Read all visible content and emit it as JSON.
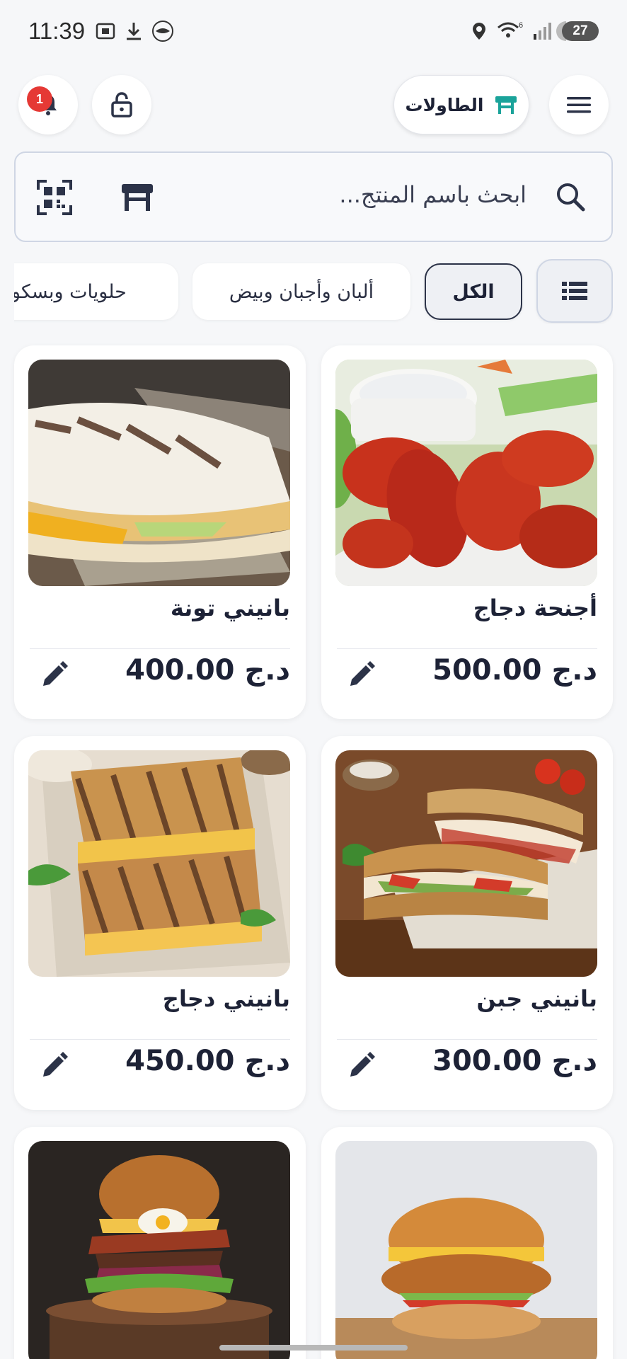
{
  "status_bar": {
    "time": "11:39",
    "battery": "27",
    "signal_label": "6"
  },
  "header": {
    "tables_label": "الطاولات",
    "notification_count": "1"
  },
  "search": {
    "placeholder": "ابحث باسم المنتج..."
  },
  "categories": [
    {
      "label": "الكل",
      "selected": true
    },
    {
      "label": "ألبان وأجبان وبيض",
      "selected": false
    },
    {
      "label": "حلويات وبسكويت",
      "selected": false
    }
  ],
  "products": [
    {
      "name": "أجنحة دجاج",
      "price": "500.00",
      "currency": "د.ج",
      "image": "chicken-wings"
    },
    {
      "name": "بانيني تونة",
      "price": "400.00",
      "currency": "د.ج",
      "image": "tuna-panini"
    },
    {
      "name": "بانيني جبن",
      "price": "300.00",
      "currency": "د.ج",
      "image": "cheese-panini"
    },
    {
      "name": "بانيني دجاج",
      "price": "450.00",
      "currency": "د.ج",
      "image": "chicken-panini"
    },
    {
      "name": "",
      "price": "",
      "currency": "",
      "image": "chicken-burger"
    },
    {
      "name": "",
      "price": "",
      "currency": "",
      "image": "bacon-burger"
    }
  ],
  "colors": {
    "accent_teal": "#1aa39a",
    "badge_red": "#e53935",
    "text_dark": "#1d2236"
  }
}
